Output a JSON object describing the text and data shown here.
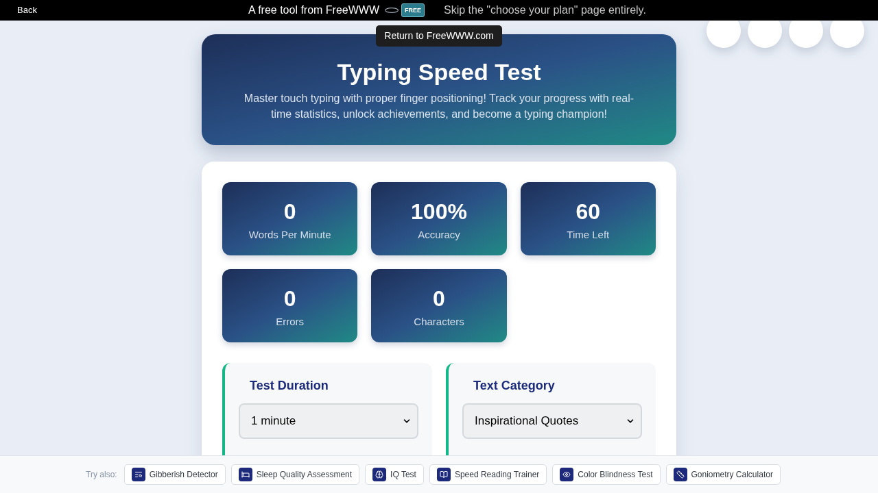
{
  "top_bar": {
    "back_link": "Back",
    "tagline": "A free tool from FreeWWW",
    "logo_text": "FREE",
    "note": "Skip the \"choose your plan\" page entirely.",
    "tooltip": "Return to FreeWWW.com"
  },
  "header": {
    "title": "Typing Speed Test",
    "subtitle": "Master touch typing with proper finger positioning! Track your progress with real-time statistics, unlock achievements, and become a typing champion!"
  },
  "stats": [
    {
      "value": "0",
      "label": "Words Per Minute"
    },
    {
      "value": "100%",
      "label": "Accuracy"
    },
    {
      "value": "60",
      "label": "Time Left"
    },
    {
      "value": "0",
      "label": "Errors"
    },
    {
      "value": "0",
      "label": "Characters"
    }
  ],
  "settings": [
    {
      "title": "Test Duration",
      "value": "1 minute"
    },
    {
      "title": "Text Category",
      "value": "Inspirational Quotes"
    }
  ],
  "footer": {
    "label": "Try also:",
    "links": [
      "Gibberish Detector",
      "Sleep Quality Assessment",
      "IQ Test",
      "Speed Reading Trainer",
      "Color Blindness Test",
      "Goniometry Calculator"
    ]
  }
}
